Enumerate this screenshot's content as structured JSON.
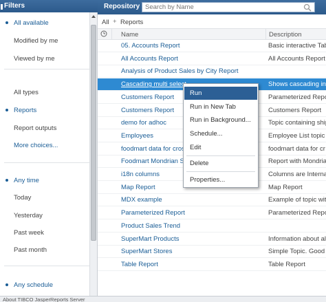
{
  "filters": {
    "title": "Filters",
    "access_group": [
      {
        "label": "All available",
        "selected": true
      },
      {
        "label": "Modified by me",
        "selected": false
      },
      {
        "label": "Viewed by me",
        "selected": false
      }
    ],
    "type_group": [
      {
        "label": "All types",
        "selected": false
      },
      {
        "label": "Reports",
        "selected": true
      },
      {
        "label": "Report outputs",
        "selected": false
      }
    ],
    "more_choices": "More choices...",
    "time_group": [
      {
        "label": "Any time",
        "selected": true
      },
      {
        "label": "Today",
        "selected": false
      },
      {
        "label": "Yesterday",
        "selected": false
      },
      {
        "label": "Past week",
        "selected": false
      },
      {
        "label": "Past month",
        "selected": false
      }
    ],
    "schedule_group": [
      {
        "label": "Any schedule",
        "selected": true
      }
    ]
  },
  "repository": {
    "title": "Repository",
    "search_placeholder": "Search by Name",
    "breadcrumb": {
      "root": "All",
      "separator": "+",
      "current": "Reports"
    },
    "columns": {
      "name": "Name",
      "description": "Description"
    },
    "rows": [
      {
        "name": "05. Accounts Report",
        "description": "Basic interactive Table"
      },
      {
        "name": "All Accounts Report",
        "description": "All Accounts Report"
      },
      {
        "name": "Analysis of Product Sales by City Report",
        "description": ""
      },
      {
        "name": "Cascading multi select",
        "description": "Shows cascading inpu",
        "selected": true
      },
      {
        "name": "Customers Report",
        "description": "Parameterized Report"
      },
      {
        "name": "Customers Report",
        "description": "Customers Report"
      },
      {
        "name": "demo for adhoc",
        "description": "Topic containing shipm"
      },
      {
        "name": "Employees",
        "description": "Employee List topic for"
      },
      {
        "name": "foodmart data for cros",
        "description": "foodmart data for cr"
      },
      {
        "name": "Foodmart Mondrian Sa",
        "description": "Report with Mondrian"
      },
      {
        "name": "i18n columns",
        "description": "Columns are Internatio"
      },
      {
        "name": "Map Report",
        "description": "Map Report"
      },
      {
        "name": "MDX example",
        "description": "Example of topic with"
      },
      {
        "name": "Parameterized Report",
        "description": "Parameterized Report"
      },
      {
        "name": "Product Sales Trend",
        "description": ""
      },
      {
        "name": "SuperMart Products",
        "description": "Information about all"
      },
      {
        "name": "SuperMart Stores",
        "description": "Simple Topic. Good fo"
      },
      {
        "name": "Table Report",
        "description": "Table Report"
      }
    ]
  },
  "context_menu": {
    "items": [
      "Run",
      "Run in New Tab",
      "Run in Background...",
      "Schedule...",
      "Edit",
      "Delete",
      "Properties..."
    ],
    "active": "Run"
  },
  "footer": {
    "text": "About TIBCO JasperReports Server"
  },
  "colors": {
    "header_blue": "#2c5a8b",
    "selection_blue": "#2e8ad2",
    "link_blue": "#1a5d96",
    "menu_active": "#2c5f95"
  }
}
